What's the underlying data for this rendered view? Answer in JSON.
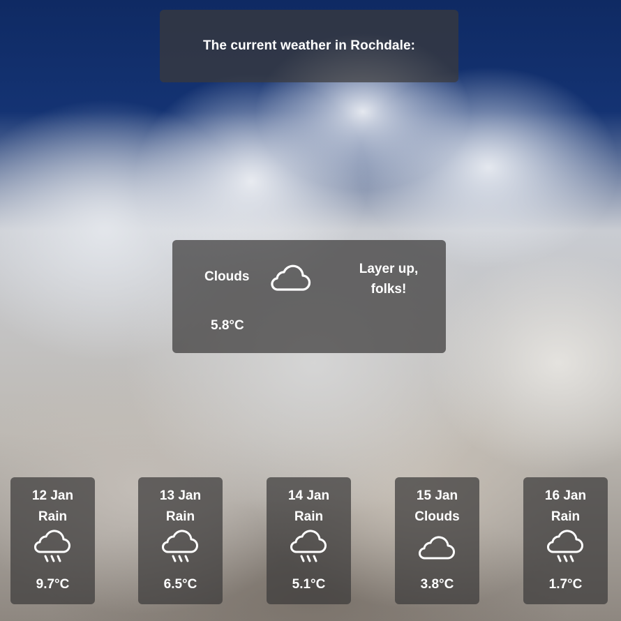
{
  "header": {
    "title": "The current weather in Rochdale:"
  },
  "current": {
    "condition": "Clouds",
    "temperature": "5.8°C",
    "advice_line1": "Layer up,",
    "advice_line2": "folks!",
    "icon": "cloud-icon"
  },
  "forecast": [
    {
      "date": "12 Jan",
      "condition": "Rain",
      "temperature": "9.7°C",
      "icon": "rain-icon"
    },
    {
      "date": "13 Jan",
      "condition": "Rain",
      "temperature": "6.5°C",
      "icon": "rain-icon"
    },
    {
      "date": "14 Jan",
      "condition": "Rain",
      "temperature": "5.1°C",
      "icon": "rain-icon"
    },
    {
      "date": "15 Jan",
      "condition": "Clouds",
      "temperature": "3.8°C",
      "icon": "cloud-icon"
    },
    {
      "date": "16 Jan",
      "condition": "Rain",
      "temperature": "1.7°C",
      "icon": "rain-icon"
    }
  ],
  "colors": {
    "panel": "#3c3a3a",
    "text": "#ffffff",
    "sky": "#143373"
  }
}
